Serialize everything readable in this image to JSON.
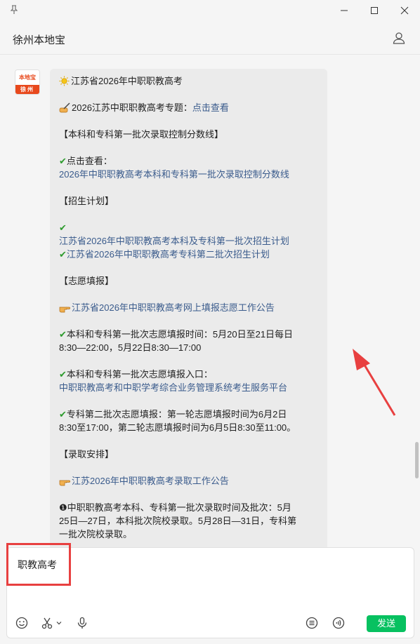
{
  "header": {
    "title": "徐州本地宝"
  },
  "avatar": {
    "logo_text": "本地宝",
    "bottom_text": "徐州"
  },
  "message": {
    "title": "江苏省2026年中职职教高考",
    "topic_prefix": "2026江苏中职职教高考专题：",
    "topic_link": "点击查看",
    "section1": "【本科和专科第一批次录取控制分数线】",
    "view_label": "点击查看：",
    "link_scoreline": "2026年中职职教高考本科和专科第一批次录取控制分数线",
    "section2": "【招生计划】",
    "link_plan1": "江苏省2026年中职职教高考本科及专科第一批次招生计划",
    "link_plan2": "江苏省2026年中职职教高考专科第二批次招生计划",
    "section3": "【志愿填报】",
    "link_notice": "江苏省2026年中职职教高考网上填报志愿工作公告",
    "fill_time_line1": "本科和专科第一批次志愿填报时间：5月20日至21日每日",
    "fill_time_line2": "8:30—22:00，5月22日8:30—17:00",
    "entry_label": "本科和专科第一批次志愿填报入口：",
    "link_platform": "中职职教高考和中职学考综合业务管理系统考生服务平台",
    "second_batch_line1": "专科第二批次志愿填报：第一轮志愿填报时间为6月2日",
    "second_batch_line2": "8:30至17:00，第二轮志愿填报时间为6月5日8:30至11:00。",
    "section4": "【录取安排】",
    "link_admission": "江苏2026年中职职教高考录取工作公告",
    "item1_line1": "❶中职职教高考本科、专科第一批次录取时间及批次：5月",
    "item1_line2": "25日—27日，本科批次院校录取。5月28日—31日，专科第",
    "item1_line3": "一批次院校录取。"
  },
  "input": {
    "value": "职教高考"
  },
  "toolbar": {
    "send_label": "发送"
  },
  "colors": {
    "accent": "#07c160",
    "link": "#3a5b8c",
    "annotation": "#e84040",
    "check": "#2e9b2e"
  }
}
